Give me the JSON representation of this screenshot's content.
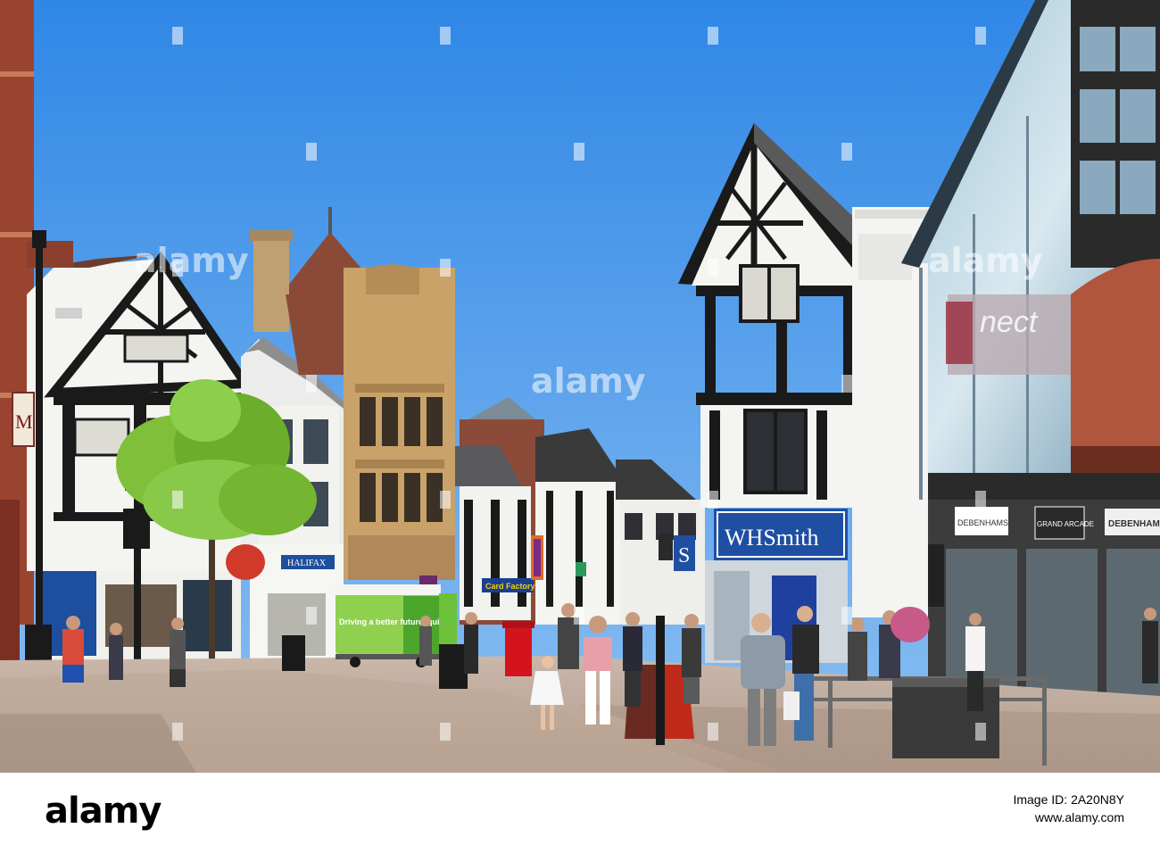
{
  "photo": {
    "watermark_text": "alamy",
    "shop_signs": {
      "whsmith": "WHSmith",
      "card_factory": "Card Factory",
      "debenhams": "DEBENHAMS",
      "debenhams_panel": "DEBENHAMS",
      "grand_arcade": "GRAND ARCADE",
      "halifax": "HALIFAX",
      "connect_glass": "nect",
      "van_slogan": "Driving a better future, quicker",
      "arcade_sign_letter": "M"
    },
    "colors": {
      "sky": "#3d8fe8",
      "timber": "#1a1a1a",
      "render": "#f4f4f0",
      "sandstone": "#c9a26a",
      "brick": "#a04632",
      "pavement": "#c2aea0",
      "whsmith_blue": "#1f4fa3",
      "tree": "#7fbf3a",
      "van_green": "#8fd14f",
      "postbox_red": "#d4141c"
    }
  },
  "footer": {
    "logo_text": "alamy",
    "image_id_label": "Image ID:",
    "image_id": "2A20N8Y",
    "site": "www.alamy.com"
  }
}
